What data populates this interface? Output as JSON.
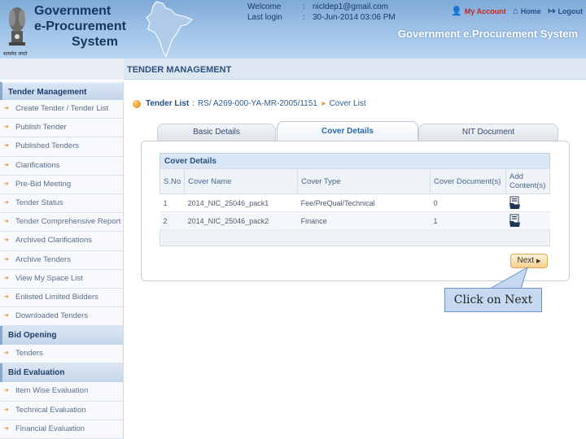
{
  "header": {
    "logo_line1": "Government",
    "logo_line2": "e-Procurement",
    "logo_line3": "System",
    "emblem_caption": "सत्यमेव जयते",
    "welcome_label": "Welcome",
    "welcome_value": "nicldep1@gmail.com",
    "lastlogin_label": "Last login",
    "lastlogin_value": "30-Jun-2014 03:06 PM",
    "my_account": "My Account",
    "home": "Home",
    "logout": "Logout",
    "system_name": "Government e.Procurement System"
  },
  "section_title": "TENDER MANAGEMENT",
  "sidebar": {
    "tender_management": {
      "header": "Tender Management",
      "items": [
        "Create Tender / Tender List",
        "Publish Tender",
        "Published Tenders",
        "Clarifications",
        "Pre-Bid Meeting",
        "Tender Status",
        "Tender Comprehensive Report",
        "Archived Clarifications",
        "Archive Tenders",
        "View My Space List",
        "Enlisted Limited Bidders",
        "Downloaded Tenders"
      ]
    },
    "bid_opening": {
      "header": "Bid Opening",
      "items": [
        "Tenders"
      ]
    },
    "bid_evaluation": {
      "header": "Bid Evaluation",
      "items": [
        "Item Wise Evaluation",
        "Technical Evaluation",
        "Financial Evaluation"
      ]
    }
  },
  "breadcrumb": {
    "title": "Tender List",
    "colon": ":",
    "ref": "RS/ A269-000-YA-MR-2005/1151",
    "current": "Cover List"
  },
  "tabs": [
    "Basic Details",
    "Cover Details",
    "NIT Document"
  ],
  "active_tab": "Cover Details",
  "cover_details": {
    "title": "Cover Details",
    "columns": [
      "S.No",
      "Cover Name",
      "Cover Type",
      "Cover Document(s)",
      "Add Content(s)"
    ],
    "rows": [
      {
        "sno": "1",
        "name": "2014_NIC_25046_pack1",
        "type": "Fee/PreQual/Technical",
        "docs": "0"
      },
      {
        "sno": "2",
        "name": "2014_NIC_25046_pack2",
        "type": "Finance",
        "docs": "1"
      }
    ]
  },
  "next_button": "Next",
  "callout": "Click on Next",
  "colors": {
    "accent": "#2a66a8",
    "header_blue": "#9cc0e6",
    "orange": "#e08a1e",
    "callout_bg": "#c6d9f0"
  }
}
